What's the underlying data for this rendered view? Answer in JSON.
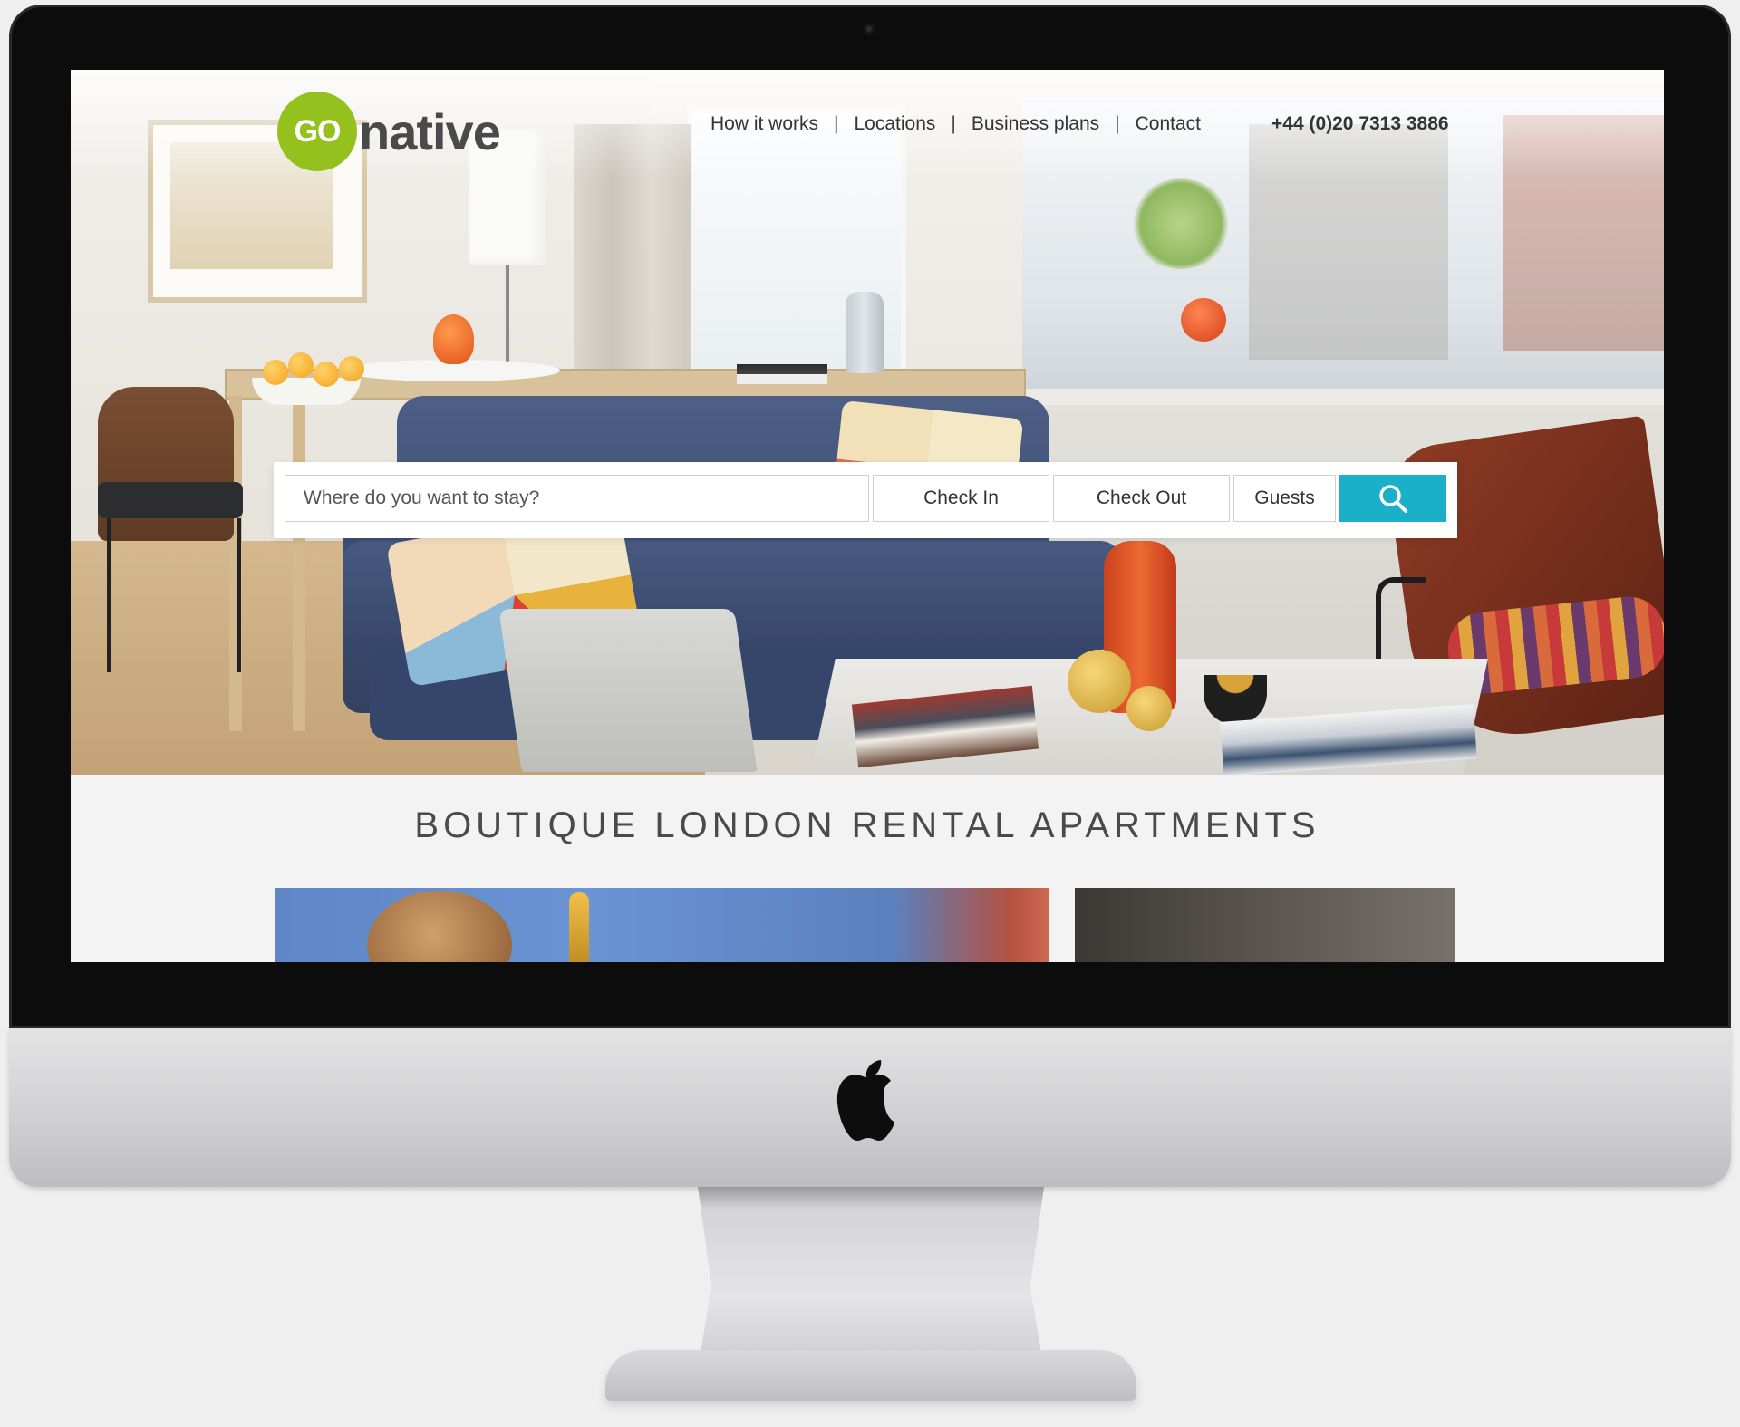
{
  "brand": {
    "logo_badge": "GO",
    "logo_word": "native",
    "accent_green": "#95c11f",
    "accent_teal": "#1ab0c9"
  },
  "nav": {
    "items": [
      "How it works",
      "Locations",
      "Business plans",
      "Contact"
    ],
    "separator": "|",
    "phone": "+44 (0)20 7313 3886"
  },
  "search": {
    "placeholder": "Where do you want to stay?",
    "check_in": "Check In",
    "check_out": "Check Out",
    "guests": "Guests",
    "button_icon": "search-icon"
  },
  "main": {
    "heading": "BOUTIQUE LONDON RENTAL APARTMENTS"
  },
  "device": {
    "logo_icon": "apple-logo-icon",
    "camera_icon": "camera-icon"
  }
}
